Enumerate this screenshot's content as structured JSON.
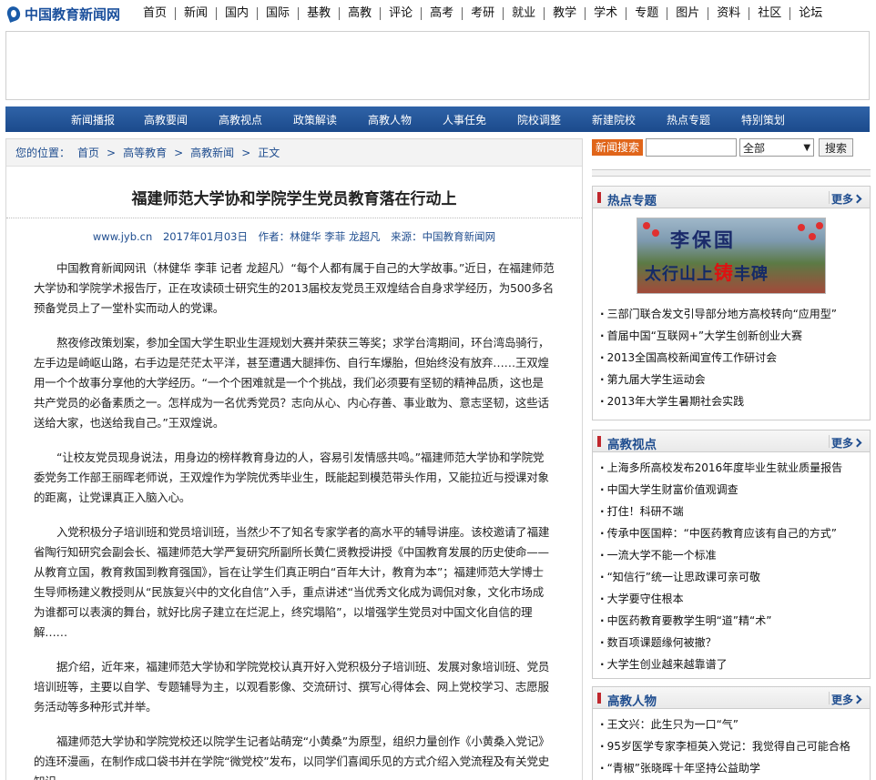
{
  "site": {
    "logo_text": "中国教育新闻网"
  },
  "topnav": [
    "首页",
    "新闻",
    "国内",
    "国际",
    "基教",
    "高教",
    "评论",
    "高考",
    "考研",
    "就业",
    "教学",
    "学术",
    "专题",
    "图片",
    "资料",
    "社区",
    "论坛"
  ],
  "bluenav": [
    "新闻播报",
    "高教要闻",
    "高教视点",
    "政策解读",
    "高教人物",
    "人事任免",
    "院校调整",
    "新建院校",
    "热点专题",
    "特别策划"
  ],
  "breadcrumb": {
    "prefix": "您的位置：",
    "items": [
      "首页",
      "高等教育",
      "高教新闻",
      "正文"
    ],
    "sep": ">"
  },
  "article": {
    "title": "福建师范大学协和学院学生党员教育落在行动上",
    "site": "www.jyb.cn",
    "date": "2017年01月03日",
    "author": "作者：林健华 李菲 龙超凡",
    "source": "来源：中国教育新闻网",
    "paragraphs": [
      "中国教育新闻网讯（林健华 李菲 记者 龙超凡）“每个人都有属于自己的大学故事。”近日，在福建师范大学协和学院学术报告厅，正在攻读硕士研究生的2013届校友党员王双煌结合自身求学经历，为500多名预备党员上了一堂朴实而动人的党课。",
      "熬夜修改策划案，参加全国大学生职业生涯规划大赛并荣获三等奖；求学台湾期间，环台湾岛骑行，左手边是崎岖山路，右手边是茫茫太平洋，甚至遭遇大腿摔伤、自行车爆胎，但始终没有放弃……王双煌用一个个故事分享他的大学经历。“一个个困难就是一个个挑战，我们必须要有坚韧的精神品质，这也是共产党员的必备素质之一。怎样成为一名优秀党员？志向从心、内心存善、事业敢为、意志坚韧，这些话送给大家，也送给我自己。”王双煌说。",
      "“让校友党员现身说法，用身边的榜样教育身边的人，容易引发情感共鸣。”福建师范大学协和学院党委党务工作部王丽晖老师说，王双煌作为学院优秀毕业生，既能起到模范带头作用，又能拉近与授课对象的距离，让党课真正入脑入心。",
      "入党积极分子培训班和党员培训班，当然少不了知名专家学者的高水平的辅导讲座。该校邀请了福建省陶行知研究会副会长、福建师范大学严复研究所副所长黄仁贤教授讲授《中国教育发展的历史使命——从教育立国，教育救国到教育强国》，旨在让学生们真正明白“百年大计，教育为本”；福建师范大学博士生导师杨建义教授则从“民族复兴中的文化自信”入手，重点讲述“当优秀文化成为调侃对象，文化市场成为谁都可以表演的舞台，就好比房子建立在烂泥上，终究塌陷”，以增强学生党员对中国文化自信的理解……",
      "据介绍，近年来，福建师范大学协和学院党校认真开好入党积极分子培训班、发展对象培训班、党员培训班等，主要以自学、专题辅导为主，以观看影像、交流研讨、撰写心得体会、网上党校学习、志愿服务活动等多种形式并举。",
      "福建师范大学协和学院党校还以院学生记者站萌宠“小黄桑”为原型，组织力量创作《小黄桑入党记》的连环漫画，在制作成口袋书并在学院“微党校”发布，以同学们喜闻乐见的方式介绍入党流程及有关党史知识。"
    ]
  },
  "search": {
    "label": "新闻搜索",
    "input_value": "",
    "select_value": "全部",
    "button": "搜索"
  },
  "hot_topics": {
    "title": "热点专题",
    "more": "更多",
    "image_caption_line1": "李保国",
    "image_caption_line2_a": "太行山上",
    "image_caption_line2_b": "铸",
    "image_caption_line2_c": "丰碑",
    "items": [
      "三部门联合发文引导部分地方高校转向“应用型”",
      "首届中国“互联网+”大学生创新创业大赛",
      "2013全国高校新闻宣传工作研讨会",
      "第九届大学生运动会",
      "2013年大学生暑期社会实践"
    ]
  },
  "viewpoints": {
    "title": "高教视点",
    "more": "更多",
    "items": [
      "上海多所高校发布2016年度毕业生就业质量报告",
      "中国大学生财富价值观调查",
      "打住！科研不端",
      "传承中医国粹：“中医药教育应该有自己的方式”",
      "一流大学不能一个标准",
      "“知信行”统一让思政课可亲可敬",
      "大学要守住根本",
      "中医药教育要教学生明“道”精“术”",
      "数百项课题缘何被撤？",
      "大学生创业越来越靠谱了"
    ]
  },
  "people": {
    "title": "高教人物",
    "more": "更多",
    "items": [
      "王文兴：此生只为一口“气”",
      "95岁医学专家李桓英入党记：我觉得自己可能合格",
      "“青椒”张晓晖十年坚持公益助学"
    ]
  }
}
